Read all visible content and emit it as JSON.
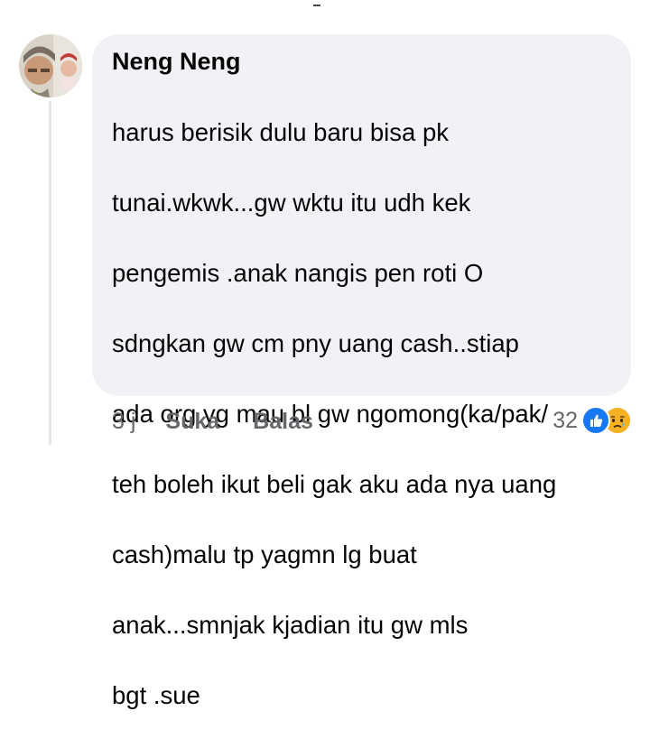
{
  "comment": {
    "author": "Neng Neng",
    "lines": [
      "harus berisik dulu baru bisa pk",
      "tunai.wkwk...gw wktu itu udh kek",
      "pengemis .anak nangis pen roti O",
      "sdngkan gw cm pny uang cash..stiap",
      "ada org yg mau bl gw ngomong(ka/pak/",
      "teh boleh ikut beli gak aku ada nya uang",
      "cash)malu tp yagmn lg buat",
      "anak...smnjak kjadian itu gw mls",
      "bgt .sue"
    ]
  },
  "actions": {
    "time": "3 j",
    "like_label": "Suka",
    "reply_label": "Balas"
  },
  "reactions": {
    "count": "32",
    "icons": [
      "like-icon",
      "sad-face-icon"
    ]
  },
  "colors": {
    "bubble_bg": "#f0f2f5",
    "text": "#050505",
    "secondary_text": "#65676b",
    "like_blue": "#1877f2",
    "sad_yellow": "#f7b125"
  }
}
